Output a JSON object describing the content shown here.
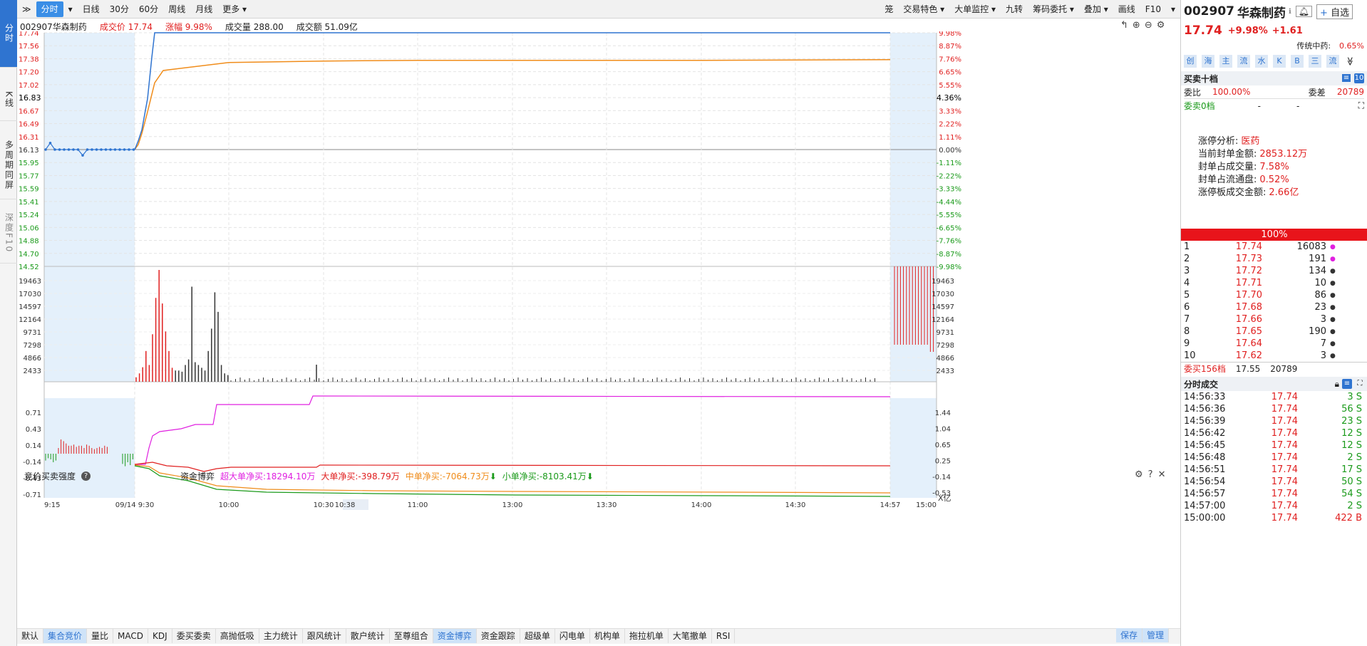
{
  "left_tabs": [
    "分时",
    "K线",
    "多周期同屏",
    "深度F10"
  ],
  "toolbar": {
    "left": [
      "分时",
      "日线",
      "30分",
      "60分",
      "周线",
      "月线",
      "更多"
    ],
    "right": [
      "笼",
      "交易特色",
      "大单监控",
      "九转",
      "筹码委托",
      "叠加",
      "画线",
      "F10"
    ]
  },
  "info": {
    "stock": "002907华森制药",
    "price_label": "成交价 17.74",
    "change_label": "涨幅 9.98%",
    "volume_label": "成交量 288.00",
    "amount_label": "成交额 51.09亿"
  },
  "price_axis": {
    "left": [
      "17.74",
      "17.56",
      "17.38",
      "17.20",
      "17.02",
      "16.83",
      "16.67",
      "16.49",
      "16.31",
      "16.13",
      "15.95",
      "15.77",
      "15.59",
      "15.41",
      "15.24",
      "15.06",
      "14.88",
      "14.70",
      "14.52"
    ],
    "right": [
      "9.98%",
      "8.87%",
      "7.76%",
      "6.65%",
      "5.55%",
      "4.36%",
      "3.33%",
      "2.22%",
      "1.11%",
      "0.00%",
      "-1.11%",
      "-2.22%",
      "-3.33%",
      "-4.44%",
      "-5.55%",
      "-6.65%",
      "-7.76%",
      "-8.87%",
      "-9.98%"
    ]
  },
  "vol_axis": [
    "19463",
    "17030",
    "14597",
    "12164",
    "9731",
    "7298",
    "4866",
    "2433"
  ],
  "indicator": {
    "left_title": "竞价买卖强度",
    "mid_title": "资金博弈",
    "super": "超大单净买:18294.10万",
    "big": "大单净买:-398.79万",
    "mid": "中单净买:-7064.73万",
    "small": "小单净买:-8103.41万",
    "left_axis": [
      "0.71",
      "0.43",
      "0.14",
      "-0.14",
      "-0.43",
      "-0.71"
    ],
    "right_axis": [
      "1.44",
      "1.04",
      "0.65",
      "0.25",
      "-0.14",
      "-0.53"
    ],
    "unit": "X亿"
  },
  "time_axis": [
    "9:15",
    "09/14 9:30",
    "10:00",
    "10:30",
    "10:38",
    "11:00",
    "13:00",
    "13:30",
    "14:00",
    "14:30",
    "14:57",
    "15:00"
  ],
  "bottom_tabs": [
    "默认",
    "集合竞价",
    "量比",
    "MACD",
    "KDJ",
    "委买委卖",
    "高抛低吸",
    "主力统计",
    "跟风统计",
    "散户统计",
    "至尊组合",
    "资金博弈",
    "资金跟踪",
    "超级单",
    "闪电单",
    "机构单",
    "拖拉机单",
    "大笔撤单",
    "RSI"
  ],
  "bottom_right": [
    "保存",
    "管理"
  ],
  "side": {
    "code": "002907",
    "name": "华森制药",
    "add_label": "自选",
    "price": "17.74",
    "pct": "+9.98%",
    "chg": "+1.61",
    "sector_label": "传统中药:",
    "sector_pct": "0.65%",
    "tags": [
      "创",
      "海",
      "主",
      "流",
      "水",
      "K",
      "B",
      "三",
      "流"
    ],
    "order_title": "买卖十档",
    "wb_label": "委比",
    "wb_value": "100.00%",
    "wc_label": "委差",
    "wc_value": "20789",
    "sell_label": "委卖0档",
    "sell_dash1": "-",
    "sell_dash2": "-",
    "limit": {
      "title": "涨停分析:",
      "title_val": "医药",
      "rows": [
        [
          "当前封单金额:",
          "2853.12万"
        ],
        [
          "封单占成交量:",
          "7.58%"
        ],
        [
          "封单占流通盘:",
          "0.52%"
        ],
        [
          "涨停板成交金额:",
          "2.66亿"
        ]
      ]
    },
    "bar_pct": "100%",
    "bids": [
      [
        "1",
        "17.74",
        "16083"
      ],
      [
        "2",
        "17.73",
        "191"
      ],
      [
        "3",
        "17.72",
        "134"
      ],
      [
        "4",
        "17.71",
        "10"
      ],
      [
        "5",
        "17.70",
        "86"
      ],
      [
        "6",
        "17.68",
        "23"
      ],
      [
        "7",
        "17.66",
        "3"
      ],
      [
        "8",
        "17.65",
        "190"
      ],
      [
        "9",
        "17.64",
        "7"
      ],
      [
        "10",
        "17.62",
        "3"
      ]
    ],
    "buy_summary": [
      "委买156档",
      "17.55",
      "20789"
    ],
    "tick_title": "分时成交",
    "ticks": [
      [
        "14:56:33",
        "17.74",
        "3 S"
      ],
      [
        "14:56:36",
        "17.74",
        "56 S"
      ],
      [
        "14:56:39",
        "17.74",
        "23 S"
      ],
      [
        "14:56:42",
        "17.74",
        "12 S"
      ],
      [
        "14:56:45",
        "17.74",
        "12 S"
      ],
      [
        "14:56:48",
        "17.74",
        "2 S"
      ],
      [
        "14:56:51",
        "17.74",
        "17 S"
      ],
      [
        "14:56:54",
        "17.74",
        "50 S"
      ],
      [
        "14:56:57",
        "17.74",
        "54 S"
      ],
      [
        "14:57:00",
        "17.74",
        "2 S"
      ],
      [
        "15:00:00",
        "17.74",
        "422 B"
      ]
    ]
  },
  "colors": {
    "up": "#e02020",
    "down": "#1a9a1a",
    "price_line": "#2f74d0",
    "avg_line": "#f08c1a",
    "super": "#e020e0",
    "big": "#e02020",
    "mid": "#f08c1a",
    "small": "#1a9a1a"
  },
  "chart_data": {
    "type": "line",
    "price_series": {
      "x": [
        "9:30",
        "9:32",
        "9:34",
        "9:36",
        "9:38",
        "9:40",
        "9:45",
        "10:00",
        "10:30",
        "11:00",
        "13:00",
        "14:00",
        "14:57"
      ],
      "values": [
        16.13,
        16.25,
        16.4,
        16.83,
        17.4,
        17.74,
        17.74,
        17.74,
        17.74,
        17.74,
        17.74,
        17.74,
        17.74
      ]
    },
    "avg_series": {
      "x": [
        "9:30",
        "9:32",
        "9:34",
        "9:36",
        "9:40",
        "9:45",
        "10:00",
        "10:30",
        "11:00",
        "13:00",
        "14:00",
        "14:57"
      ],
      "values": [
        16.13,
        16.2,
        16.35,
        16.65,
        17.05,
        17.22,
        17.33,
        17.35,
        17.36,
        17.36,
        17.36,
        17.37
      ]
    },
    "ylim": [
      14.52,
      17.74
    ]
  }
}
